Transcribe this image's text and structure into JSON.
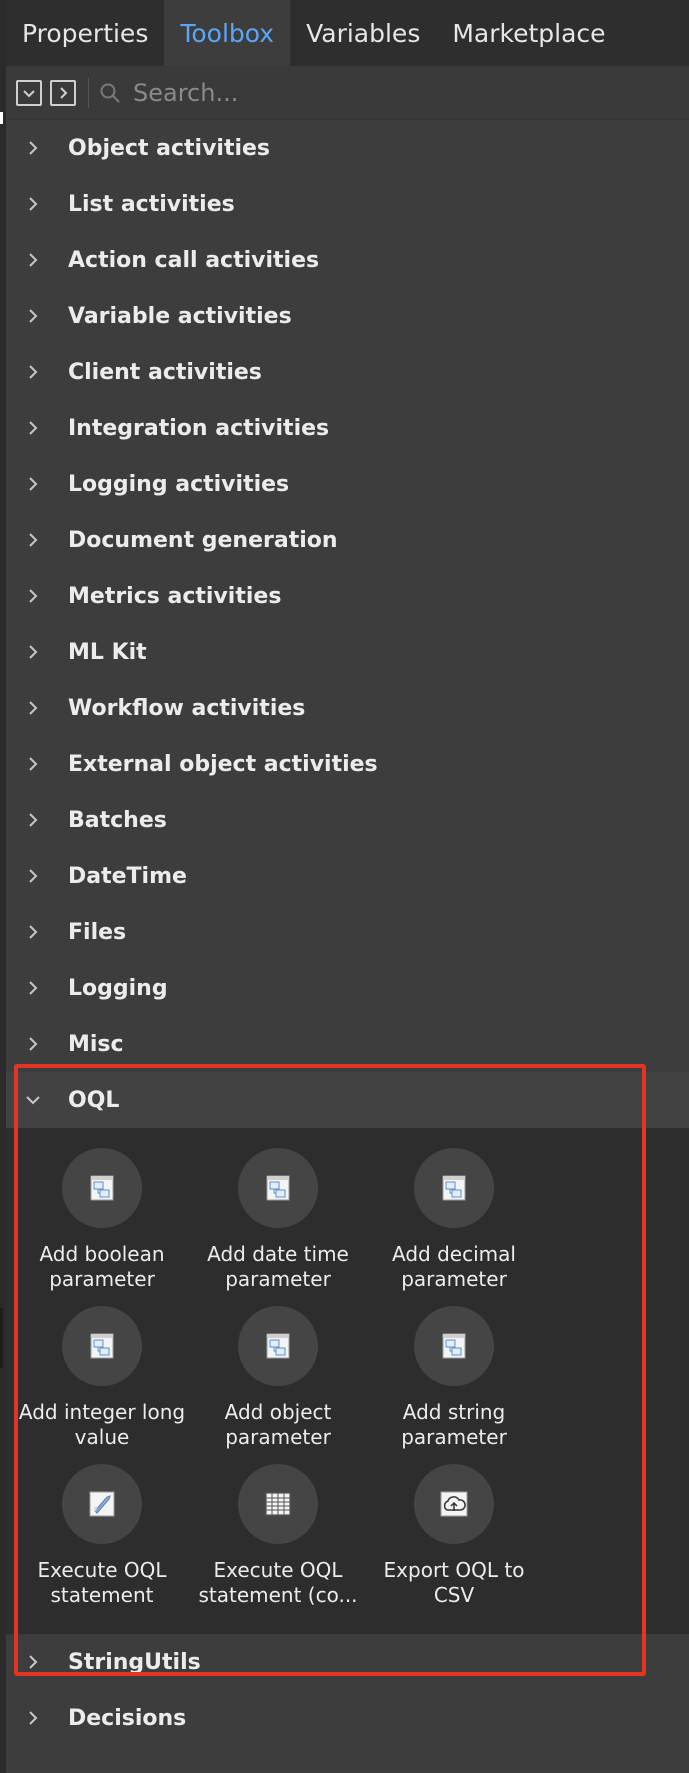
{
  "tabs": [
    {
      "label": "Properties",
      "active": false
    },
    {
      "label": "Toolbox",
      "active": true
    },
    {
      "label": "Variables",
      "active": false
    },
    {
      "label": "Marketplace",
      "active": false
    }
  ],
  "search": {
    "placeholder": "Search..."
  },
  "categories_before": [
    "Object activities",
    "List activities",
    "Action call activities",
    "Variable activities",
    "Client activities",
    "Integration activities",
    "Logging activities",
    "Document generation",
    "Metrics activities",
    "ML Kit",
    "Workflow activities",
    "External object activities",
    "Batches",
    "DateTime",
    "Files",
    "Logging",
    "Misc"
  ],
  "expanded_category": {
    "label": "OQL",
    "tools": [
      {
        "label": "Add boolean parameter",
        "icon": "parameter-icon"
      },
      {
        "label": "Add date time parameter",
        "icon": "parameter-icon"
      },
      {
        "label": "Add decimal parameter",
        "icon": "parameter-icon"
      },
      {
        "label": "Add integer long value",
        "icon": "parameter-icon"
      },
      {
        "label": "Add object parameter",
        "icon": "parameter-icon"
      },
      {
        "label": "Add string parameter",
        "icon": "parameter-icon"
      },
      {
        "label": "Execute OQL statement",
        "icon": "rocket-icon"
      },
      {
        "label": "Execute OQL statement (co...",
        "icon": "table-icon"
      },
      {
        "label": "Export OQL to CSV",
        "icon": "cloud-upload-icon"
      }
    ]
  },
  "categories_after": [
    "StringUtils",
    "Decisions"
  ],
  "colors": {
    "accent_tab": "#5aa6f5",
    "highlight_box": "#e53324",
    "panel_bg": "#3d3d3d"
  }
}
